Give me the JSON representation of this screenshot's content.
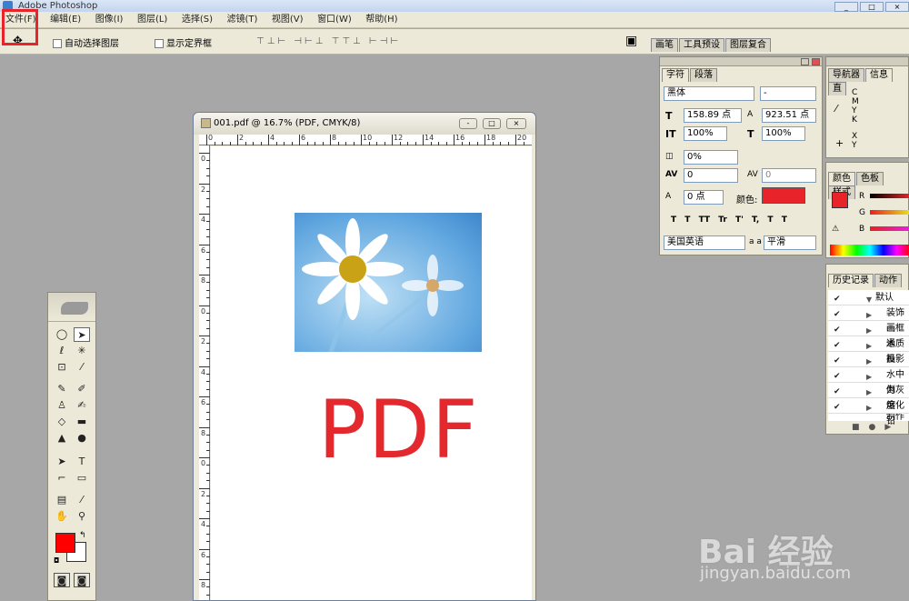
{
  "app": {
    "title": "Adobe Photoshop"
  },
  "menu": [
    "文件(F)",
    "编辑(E)",
    "图像(I)",
    "图层(L)",
    "选择(S)",
    "滤镜(T)",
    "视图(V)",
    "窗口(W)",
    "帮助(H)"
  ],
  "options": {
    "auto_select": "自动选择图层",
    "show_bounds": "显示定界框"
  },
  "palette_well": {
    "tabs": [
      "画笔",
      "工具预设",
      "图层复合"
    ]
  },
  "document": {
    "title": "001.pdf @ 16.7% (PDF, CMYK/8)",
    "watermark": "PDF",
    "ruler_h": [
      "0",
      "2",
      "4",
      "6",
      "8",
      "10",
      "12",
      "14",
      "16",
      "18",
      "20"
    ],
    "ruler_v": [
      "0",
      "2",
      "4",
      "6",
      "8",
      "0",
      "2",
      "4",
      "6",
      "8",
      "0",
      "2",
      "4",
      "6",
      "8"
    ]
  },
  "character": {
    "tabs": [
      "字符",
      "段落"
    ],
    "font": "黑体",
    "style": "-",
    "size": "158.89 点",
    "leading": "923.51 点",
    "vscale": "100%",
    "hscale": "100%",
    "tracking": "0%",
    "kerning": "0",
    "baseline_shift_label": "0",
    "baseline": "0 点",
    "color_label": "颜色:",
    "color": "#e8232a",
    "language": "美国英语",
    "aa_label": "a a",
    "aa": "平滑",
    "style_buttons": [
      "T",
      "T",
      "TT",
      "Tr",
      "T'",
      "T,",
      "T",
      "T"
    ]
  },
  "navigator": {
    "tabs": [
      "导航器",
      "信息",
      "直"
    ],
    "cmyk": [
      "C",
      "M",
      "Y",
      "K"
    ],
    "xy": [
      "X",
      "Y"
    ]
  },
  "color_panel": {
    "tabs": [
      "颜色",
      "色板",
      "样式"
    ],
    "channels": [
      "R",
      "G",
      "B"
    ],
    "fg": "#e8232a"
  },
  "history": {
    "tabs": [
      "历史记录",
      "动作"
    ],
    "items": [
      "默认",
      "装饰画",
      "画框通",
      "木质画",
      "投影",
      "水中倒",
      "为灰度",
      "熔化铅",
      "制作"
    ]
  },
  "toolbox": {
    "fg_color": "#ff0000",
    "bg_color": "#ffffff"
  },
  "watermark": {
    "brand": "Bai  经验",
    "url": "jingyan.baidu.com"
  }
}
